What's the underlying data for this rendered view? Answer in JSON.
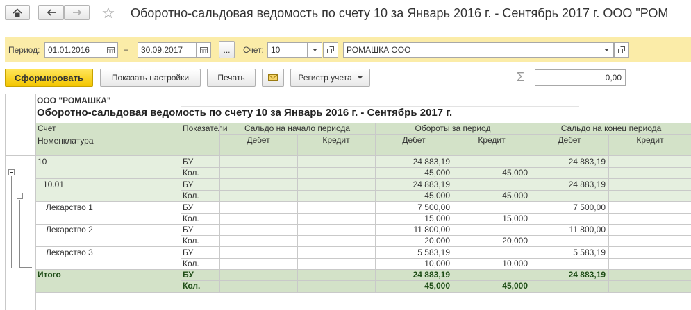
{
  "window": {
    "title": "Оборотно-сальдовая ведомость по счету 10 за Январь 2016 г. - Сентябрь 2017 г. ООО \"РОМ"
  },
  "filters": {
    "period_label": "Период:",
    "date_from": "01.01.2016",
    "dash": "–",
    "date_to": "30.09.2017",
    "more_label": "...",
    "account_label": "Счет:",
    "account_value": "10",
    "organization_value": "РОМАШКА ООО"
  },
  "toolbar": {
    "generate_label": "Сформировать",
    "settings_label": "Показать настройки",
    "print_label": "Печать",
    "register_label": "Регистр учета",
    "sum_symbol": "Σ",
    "sum_value": "0,00"
  },
  "report": {
    "company": "ООО \"РОМАШКА\"",
    "heading": "Оборотно-сальдовая ведомость по счету 10 за Январь 2016 г. - Сентябрь 2017 г.",
    "headers": {
      "account": "Счет",
      "nomenclature": "Номенклатура",
      "indicators": "Показатели",
      "opening": "Сальдо на начало периода",
      "turnover": "Обороты за период",
      "closing": "Сальдо на конец периода",
      "debit": "Дебет",
      "credit": "Кредит"
    },
    "rows": [
      {
        "name": "10",
        "bu": {
          "tdebit": "24 883,19",
          "tcredit": "",
          "cdebit": "24 883,19"
        },
        "qty": {
          "tdebit": "45,000",
          "tcredit": "45,000",
          "cdebit": ""
        }
      },
      {
        "name": "10.01",
        "bu": {
          "tdebit": "24 883,19",
          "tcredit": "",
          "cdebit": "24 883,19"
        },
        "qty": {
          "tdebit": "45,000",
          "tcredit": "45,000",
          "cdebit": ""
        }
      },
      {
        "name": "Лекарство 1",
        "bu": {
          "tdebit": "7 500,00",
          "tcredit": "",
          "cdebit": "7 500,00"
        },
        "qty": {
          "tdebit": "15,000",
          "tcredit": "15,000",
          "cdebit": ""
        }
      },
      {
        "name": "Лекарство 2",
        "bu": {
          "tdebit": "11 800,00",
          "tcredit": "",
          "cdebit": "11 800,00"
        },
        "qty": {
          "tdebit": "20,000",
          "tcredit": "20,000",
          "cdebit": ""
        }
      },
      {
        "name": "Лекарство 3",
        "bu": {
          "tdebit": "5 583,19",
          "tcredit": "",
          "cdebit": "5 583,19"
        },
        "qty": {
          "tdebit": "10,000",
          "tcredit": "10,000",
          "cdebit": ""
        }
      }
    ],
    "total": {
      "name": "Итого",
      "bu": {
        "tdebit": "24 883,19",
        "tcredit": "",
        "cdebit": "24 883,19"
      },
      "qty": {
        "tdebit": "45,000",
        "tcredit": "45,000",
        "cdebit": ""
      }
    },
    "ind_bu": "БУ",
    "ind_qty": "Кол."
  },
  "icons": {
    "home": "home-icon",
    "back": "arrow-left-icon",
    "forward": "arrow-right-icon",
    "favorite": "star-icon",
    "calendar": "calendar-icon",
    "dropdown": "chevron-down-icon",
    "open": "open-icon",
    "email": "envelope-icon",
    "sum": "sigma-icon"
  }
}
